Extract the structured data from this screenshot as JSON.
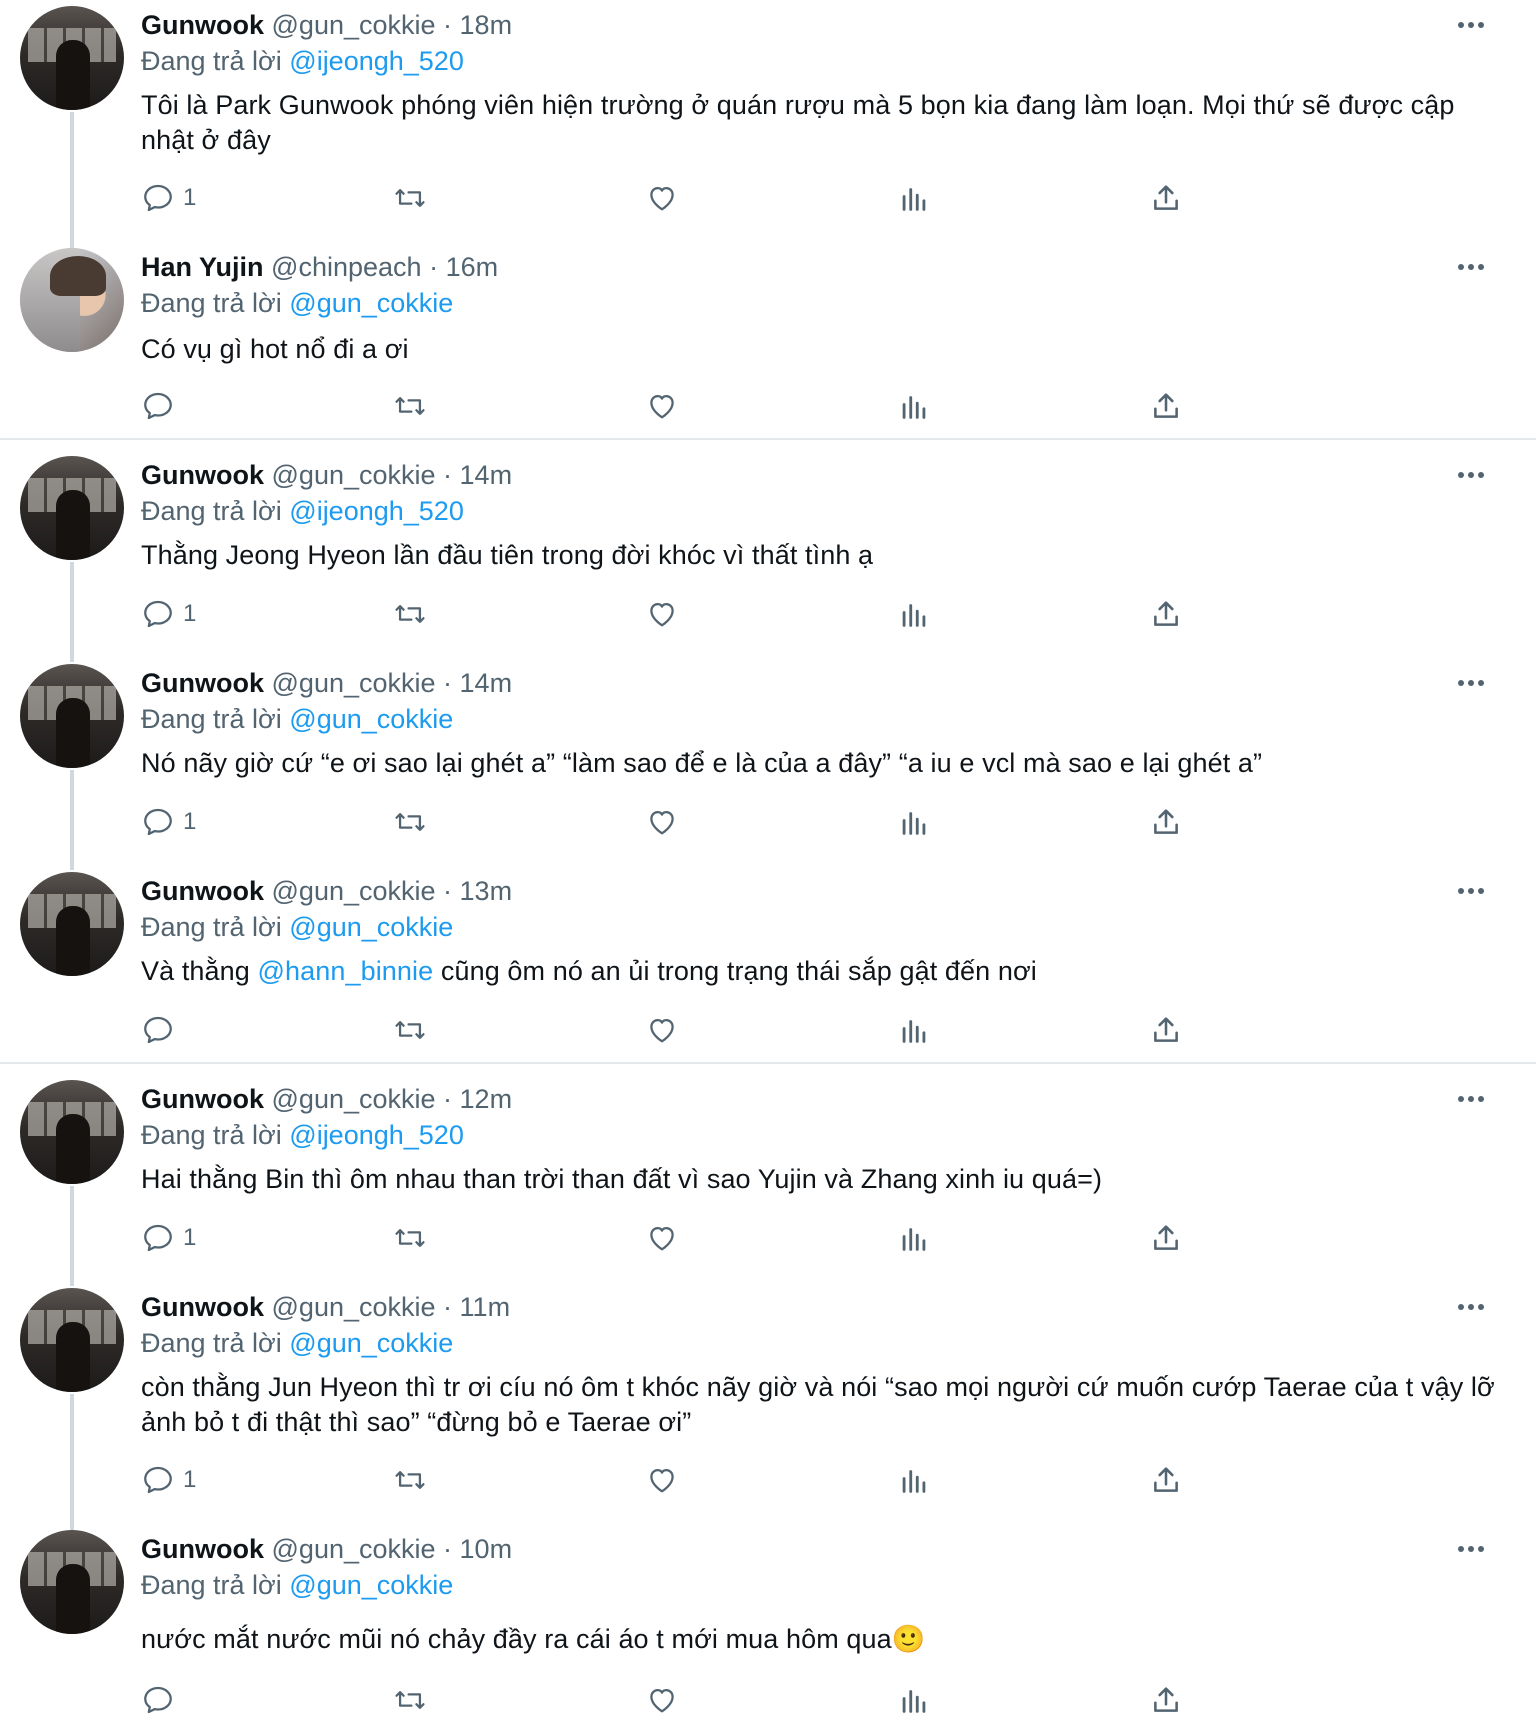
{
  "tweets": [
    {
      "name": "Gunwook",
      "handle": "@gun_cokkie",
      "time": "· 18m",
      "reply_prefix": "Đang trả lời",
      "reply_to": "@ijeongh_520",
      "text": "Tôi là Park Gunwook phóng viên hiện trường ở quán rượu mà 5 bọn kia đang làm loạn. Mọi thứ sẽ được cập nhật ở đây",
      "reply_count": "1",
      "avatar": "dark"
    },
    {
      "name": "Han Yujin",
      "handle": "@chinpeach",
      "time": "· 16m",
      "reply_prefix": "Đang trả lời",
      "reply_to": "@gun_cokkie",
      "text": "Có vụ gì hot nổ đi a ơi",
      "reply_count": "",
      "avatar": "light"
    },
    {
      "name": "Gunwook",
      "handle": "@gun_cokkie",
      "time": "· 14m",
      "reply_prefix": "Đang trả lời",
      "reply_to": "@ijeongh_520",
      "text": "Thằng Jeong Hyeon lần đầu tiên trong đời khóc vì thất tình ạ",
      "reply_count": "1",
      "avatar": "dark"
    },
    {
      "name": "Gunwook",
      "handle": "@gun_cokkie",
      "time": "· 14m",
      "reply_prefix": "Đang trả lời",
      "reply_to": "@gun_cokkie",
      "text": "Nó nãy giờ cứ “e ơi sao lại ghét a” “làm sao để e là của a đây” “a iu e vcl mà sao e lại ghét a”",
      "reply_count": "1",
      "avatar": "dark"
    },
    {
      "name": "Gunwook",
      "handle": "@gun_cokkie",
      "time": "· 13m",
      "reply_prefix": "Đang trả lời",
      "reply_to": "@gun_cokkie",
      "text_before": "Và thằng ",
      "text_mention": "@hann_binnie",
      "text_after": " cũng ôm nó an ủi trong trạng thái sắp gật đến nơi",
      "reply_count": "",
      "avatar": "dark"
    },
    {
      "name": "Gunwook",
      "handle": "@gun_cokkie",
      "time": "· 12m",
      "reply_prefix": "Đang trả lời",
      "reply_to": "@ijeongh_520",
      "text": "Hai thằng Bin thì ôm nhau than trời than đất vì sao Yujin và Zhang xinh iu quá=)",
      "reply_count": "1",
      "avatar": "dark"
    },
    {
      "name": "Gunwook",
      "handle": "@gun_cokkie",
      "time": "· 11m",
      "reply_prefix": "Đang trả lời",
      "reply_to": "@gun_cokkie",
      "text": "còn thằng Jun Hyeon thì tr ơi cíu nó ôm t khóc nãy giờ và nói “sao mọi người cứ muốn cướp Taerae của t vậy lỡ ảnh bỏ t đi thật thì sao” “đừng bỏ e Taerae ơi”",
      "reply_count": "1",
      "avatar": "dark"
    },
    {
      "name": "Gunwook",
      "handle": "@gun_cokkie",
      "time": "· 10m",
      "reply_prefix": "Đang trả lời",
      "reply_to": "@gun_cokkie",
      "text": "nước mắt nước mũi nó chảy đầy ra cái áo t mới mua hôm qua🙂",
      "reply_count": "",
      "avatar": "dark"
    }
  ]
}
